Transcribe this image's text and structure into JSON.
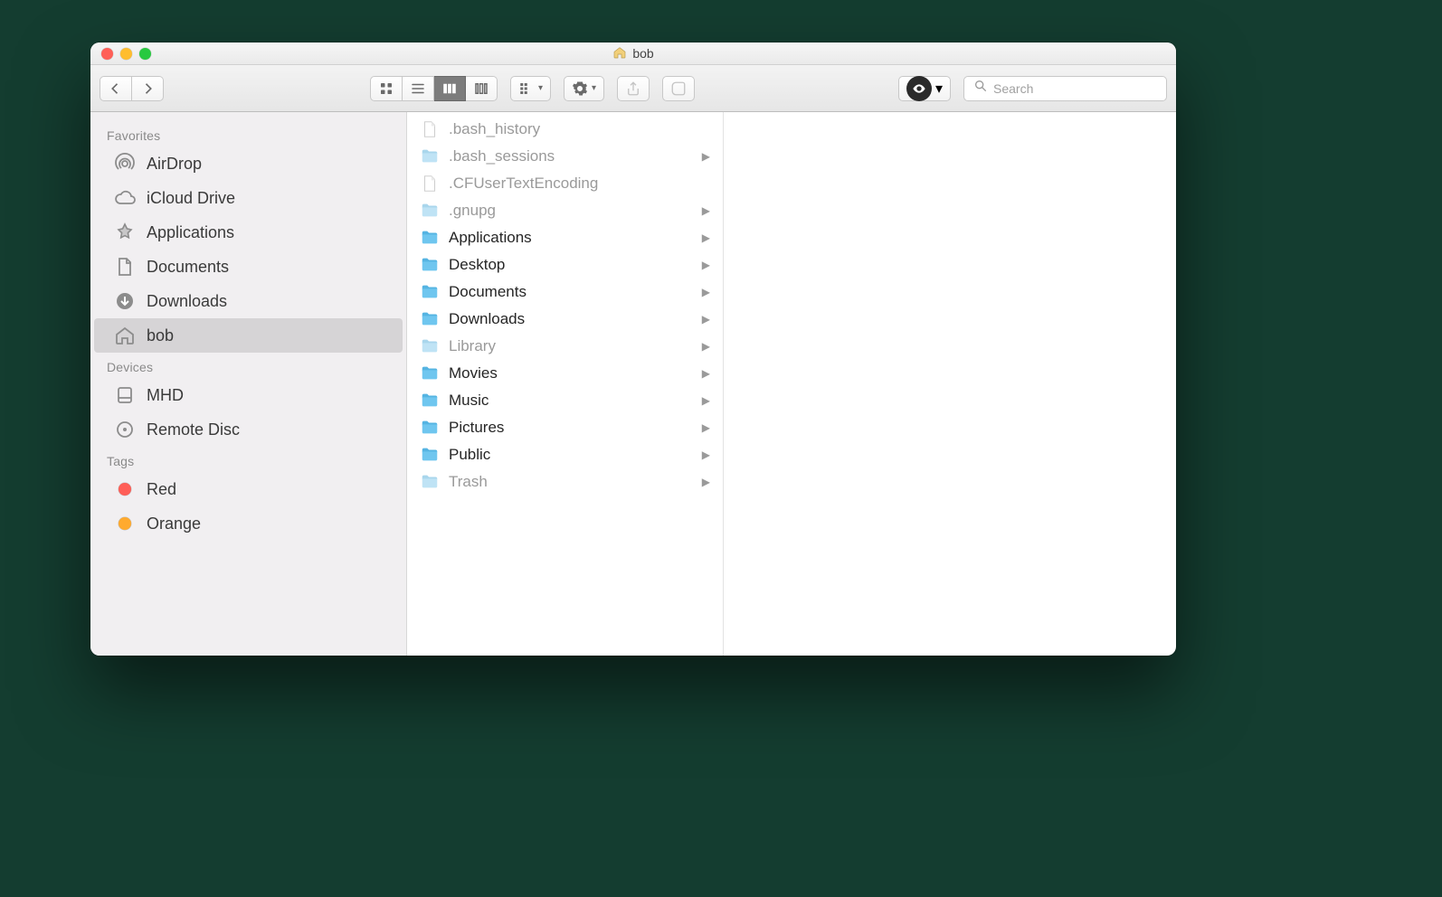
{
  "window": {
    "title": "bob"
  },
  "toolbar": {
    "search_placeholder": "Search"
  },
  "sidebar": {
    "sections": [
      {
        "heading": "Favorites",
        "items": [
          {
            "icon": "airdrop",
            "label": "AirDrop",
            "selected": false
          },
          {
            "icon": "cloud",
            "label": "iCloud Drive",
            "selected": false
          },
          {
            "icon": "apps",
            "label": "Applications",
            "selected": false
          },
          {
            "icon": "doc",
            "label": "Documents",
            "selected": false
          },
          {
            "icon": "download",
            "label": "Downloads",
            "selected": false
          },
          {
            "icon": "home",
            "label": "bob",
            "selected": true
          }
        ]
      },
      {
        "heading": "Devices",
        "items": [
          {
            "icon": "disk",
            "label": "MHD",
            "selected": false
          },
          {
            "icon": "remotedisc",
            "label": "Remote Disc",
            "selected": false
          }
        ]
      },
      {
        "heading": "Tags",
        "items": [
          {
            "icon": "tag",
            "color": "#ff5e57",
            "label": "Red",
            "selected": false
          },
          {
            "icon": "tag",
            "color": "#ffaa2e",
            "label": "Orange",
            "selected": false
          }
        ]
      }
    ]
  },
  "column": {
    "items": [
      {
        "type": "file",
        "label": ".bash_history",
        "dim": true,
        "expandable": false
      },
      {
        "type": "folder",
        "label": ".bash_sessions",
        "dim": true,
        "expandable": true
      },
      {
        "type": "file",
        "label": ".CFUserTextEncoding",
        "dim": true,
        "expandable": false
      },
      {
        "type": "folder",
        "label": ".gnupg",
        "dim": true,
        "expandable": true
      },
      {
        "type": "folder-app",
        "label": "Applications",
        "dim": false,
        "expandable": true
      },
      {
        "type": "folder",
        "label": "Desktop",
        "dim": false,
        "expandable": true
      },
      {
        "type": "folder",
        "label": "Documents",
        "dim": false,
        "expandable": true
      },
      {
        "type": "folder",
        "label": "Downloads",
        "dim": false,
        "expandable": true
      },
      {
        "type": "folder",
        "label": "Library",
        "dim": true,
        "expandable": true
      },
      {
        "type": "folder",
        "label": "Movies",
        "dim": false,
        "expandable": true
      },
      {
        "type": "folder",
        "label": "Music",
        "dim": false,
        "expandable": true
      },
      {
        "type": "folder",
        "label": "Pictures",
        "dim": false,
        "expandable": true
      },
      {
        "type": "folder",
        "label": "Public",
        "dim": false,
        "expandable": true
      },
      {
        "type": "folder",
        "label": "Trash",
        "dim": true,
        "expandable": true
      }
    ]
  }
}
